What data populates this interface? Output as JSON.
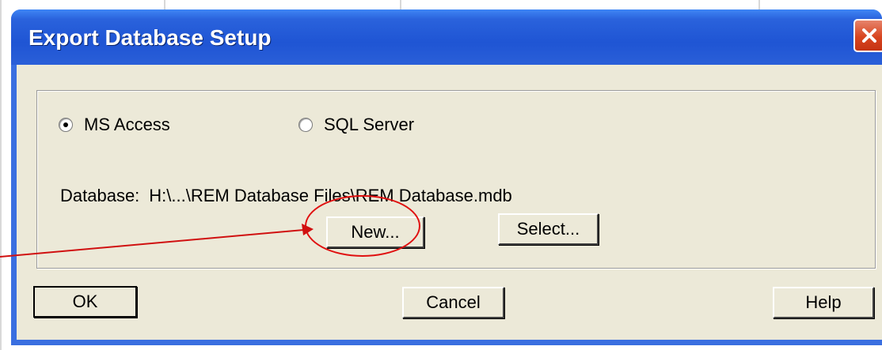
{
  "window": {
    "title": "Export Database Setup"
  },
  "database_type": {
    "options": [
      {
        "label": "MS Access",
        "selected": true
      },
      {
        "label": "SQL Server",
        "selected": false
      }
    ]
  },
  "database": {
    "label": "Database:",
    "path": "H:\\...\\REM Database Files\\REM Database.mdb"
  },
  "buttons": {
    "new": "New...",
    "select": "Select...",
    "ok": "OK",
    "cancel": "Cancel",
    "help": "Help"
  },
  "colors": {
    "titlebar": "#1f55d4",
    "client": "#ece9d8",
    "annotation": "#e01010"
  },
  "icons": {
    "close": "close-icon"
  }
}
